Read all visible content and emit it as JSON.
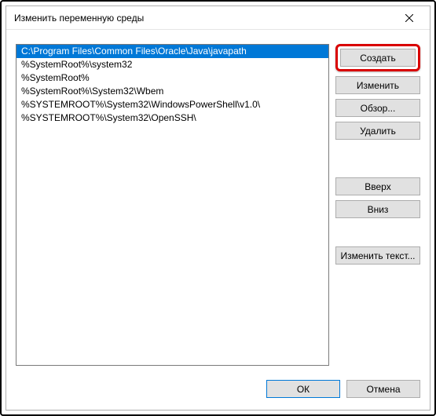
{
  "window": {
    "title": "Изменить переменную среды"
  },
  "pathList": {
    "items": [
      "C:\\Program Files\\Common Files\\Oracle\\Java\\javapath",
      "%SystemRoot%\\system32",
      "%SystemRoot%",
      "%SystemRoot%\\System32\\Wbem",
      "%SYSTEMROOT%\\System32\\WindowsPowerShell\\v1.0\\",
      "%SYSTEMROOT%\\System32\\OpenSSH\\"
    ],
    "selectedIndex": 0
  },
  "buttons": {
    "create": "Создать",
    "edit": "Изменить",
    "browse": "Обзор...",
    "delete": "Удалить",
    "up": "Вверх",
    "down": "Вниз",
    "editText": "Изменить текст...",
    "ok": "ОК",
    "cancel": "Отмена"
  }
}
